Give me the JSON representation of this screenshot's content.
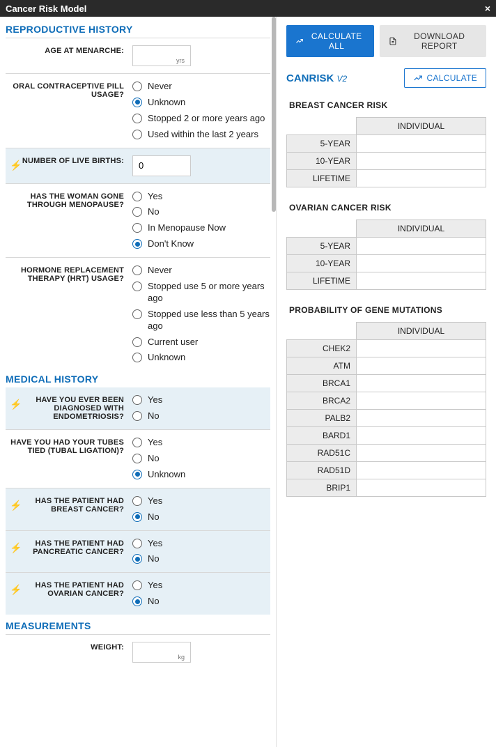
{
  "titlebar": {
    "title": "Cancer Risk Model",
    "close": "×"
  },
  "sections": {
    "reproductive": "REPRODUCTIVE HISTORY",
    "medical": "MEDICAL HISTORY",
    "measurements": "MEASUREMENTS"
  },
  "fields": {
    "menarche": {
      "label": "AGE AT MENARCHE:",
      "unit": "yrs",
      "value": ""
    },
    "ocp": {
      "label": "ORAL CONTRACEPTIVE PILL USAGE?",
      "options": [
        "Never",
        "Unknown",
        "Stopped 2 or more years ago",
        "Used within the last 2 years"
      ],
      "selected": 1
    },
    "births": {
      "label": "NUMBER OF LIVE BIRTHS:",
      "value": "0"
    },
    "menopause": {
      "label": "HAS THE WOMAN GONE THROUGH MENOPAUSE?",
      "options": [
        "Yes",
        "No",
        "In Menopause Now",
        "Don't Know"
      ],
      "selected": 3
    },
    "hrt": {
      "label": "HORMONE REPLACEMENT THERAPY (HRT) USAGE?",
      "options": [
        "Never",
        "Stopped use 5 or more years ago",
        "Stopped use less than 5 years ago",
        "Current user",
        "Unknown"
      ],
      "selected": -1
    },
    "endometriosis": {
      "label": "HAVE YOU EVER BEEN DIAGNOSED WITH ENDOMETRIOSIS?",
      "options": [
        "Yes",
        "No"
      ],
      "selected": -1
    },
    "tubal": {
      "label": "HAVE YOU HAD YOUR TUBES TIED (TUBAL LIGATION)?",
      "options": [
        "Yes",
        "No",
        "Unknown"
      ],
      "selected": 2
    },
    "breast_cancer": {
      "label": "HAS THE PATIENT HAD BREAST CANCER?",
      "options": [
        "Yes",
        "No"
      ],
      "selected": 1
    },
    "pancreatic_cancer": {
      "label": "HAS THE PATIENT HAD PANCREATIC CANCER?",
      "options": [
        "Yes",
        "No"
      ],
      "selected": 1
    },
    "ovarian_cancer": {
      "label": "HAS THE PATIENT HAD OVARIAN CANCER?",
      "options": [
        "Yes",
        "No"
      ],
      "selected": 1
    },
    "weight": {
      "label": "WEIGHT:",
      "unit": "kg",
      "value": ""
    }
  },
  "buttons": {
    "calculate_all": "CALCULATE ALL",
    "download_report": "DOWNLOAD REPORT",
    "calculate": "CALCULATE"
  },
  "canrisk": {
    "name": "CANRISK",
    "version": "V2"
  },
  "risk_tables": {
    "breast": {
      "heading": "BREAST CANCER RISK",
      "col": "INDIVIDUAL",
      "rows": [
        "5-YEAR",
        "10-YEAR",
        "LIFETIME"
      ]
    },
    "ovarian": {
      "heading": "OVARIAN CANCER RISK",
      "col": "INDIVIDUAL",
      "rows": [
        "5-YEAR",
        "10-YEAR",
        "LIFETIME"
      ]
    },
    "mutations": {
      "heading": "PROBABILITY OF GENE MUTATIONS",
      "col": "INDIVIDUAL",
      "rows": [
        "CHEK2",
        "ATM",
        "BRCA1",
        "BRCA2",
        "PALB2",
        "BARD1",
        "RAD51C",
        "RAD51D",
        "BRIP1"
      ]
    }
  }
}
